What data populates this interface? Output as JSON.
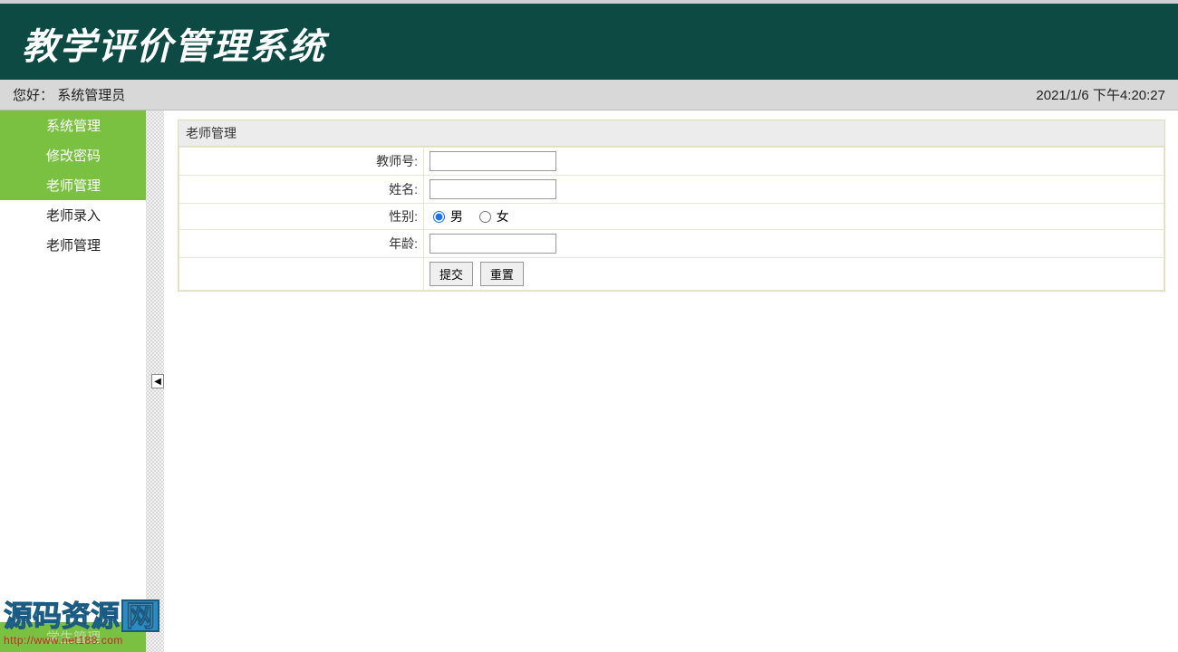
{
  "header": {
    "title": "教学评价管理系统"
  },
  "infobar": {
    "greeting_prefix": "您好：",
    "username": "系统管理员",
    "timestamp": "2021/1/6 下午4:20:27"
  },
  "sidebar": {
    "sections": [
      {
        "label": "系统管理",
        "active": true
      },
      {
        "label": "修改密码",
        "active": true
      },
      {
        "label": "老师管理",
        "active": true
      }
    ],
    "items": [
      {
        "label": "老师录入"
      },
      {
        "label": "老师管理"
      }
    ],
    "bottom_hint": "学生管理",
    "collapse_glyph": "◀"
  },
  "panel": {
    "title": "老师管理",
    "fields": {
      "teacher_id": {
        "label": "教师号:",
        "value": ""
      },
      "name": {
        "label": "姓名:",
        "value": ""
      },
      "gender": {
        "label": "性别:",
        "male": "男",
        "female": "女",
        "selected": "male"
      },
      "age": {
        "label": "年龄:",
        "value": ""
      }
    },
    "buttons": {
      "submit": "提交",
      "reset": "重置"
    }
  },
  "watermark": {
    "text": "源码资源",
    "net": "网",
    "url": "http://www.net188.com"
  }
}
